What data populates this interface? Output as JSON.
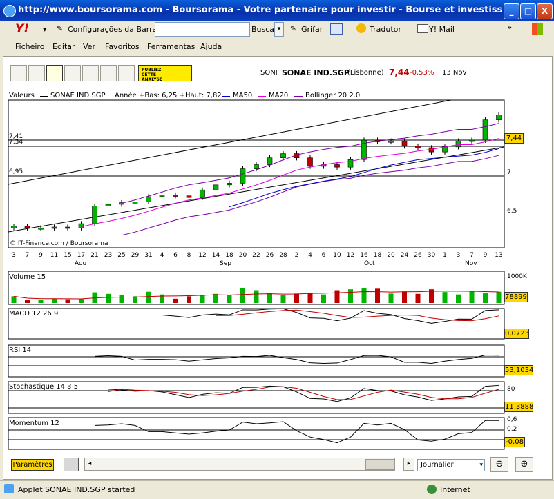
{
  "window": {
    "title": "http://www.boursorama.com - Boursorama - Votre partenaire pour investir - Bourse et investissem - Microsoft ...",
    "buttons": [
      "_",
      "□",
      "X"
    ]
  },
  "ie_toolbar": {
    "yahoo": "Y!",
    "config": "Configurações da Barra",
    "search_btn": "Buscar",
    "grifar": "Grifar",
    "tradutor": "Tradutor",
    "ymail": "Y! Mail"
  },
  "menu": [
    "Ficheiro",
    "Editar",
    "Ver",
    "Favoritos",
    "Ferramentas",
    "Ajuda"
  ],
  "chart_header": {
    "publiez": "PUBLIEZ CETTE ANALYSE",
    "code": "SONI",
    "name": "SONAE IND.SGP",
    "exchange": "(Lisbonne)",
    "price": "7,44",
    "change": "-0,53%",
    "date": "13 Nov"
  },
  "legend": {
    "valeurs": "Valeurs",
    "series": "SONAE IND.SGP",
    "annee": "Année +Bas: 6,25 +Haut: 7,82",
    "ma50": "MA50",
    "ma20": "MA20",
    "bollinger": "Bollinger 20 2.0"
  },
  "colors": {
    "ma50": "#0000CC",
    "ma20": "#DD00DD",
    "bollinger": "#7A00AA",
    "up": "#00B400",
    "down": "#C00000",
    "badge": "#FFD700"
  },
  "copyright": "© IT-Finance.com / Boursorama",
  "price_panel": {
    "right_ticks": [
      "7",
      "6,5"
    ],
    "left_levels": [
      "7,41",
      "7,34",
      "6,95"
    ],
    "last": "7,44"
  },
  "x_days": [
    "3",
    "7",
    "9",
    "11",
    "15",
    "17",
    "21",
    "23",
    "25",
    "29",
    "31",
    "4",
    "6",
    "8",
    "12",
    "14",
    "18",
    "20",
    "22",
    "26",
    "28",
    "2",
    "4",
    "6",
    "10",
    "12",
    "16",
    "18",
    "20",
    "24",
    "26",
    "30",
    "1",
    "3",
    "7",
    "9",
    "13"
  ],
  "months": [
    "Aou",
    "Sep",
    "Oct",
    "Nov"
  ],
  "panels": {
    "volume": {
      "label": "Volume 15",
      "scale": "1000K",
      "value": "78899"
    },
    "macd": {
      "label": "MACD 12 26 9",
      "value": "0,0723"
    },
    "rsi": {
      "label": "RSI 14",
      "value": "53,1034"
    },
    "stoch": {
      "label": "Stochastique 14 3 5",
      "scale": "80",
      "value": "11,3888"
    },
    "momentum": {
      "label": "Momentum 12",
      "scale_top": "0,6",
      "scale_mid": "0,2",
      "value": "-0,08"
    }
  },
  "bottom": {
    "params": "Paramètres",
    "period": "Journalier"
  },
  "status": {
    "text": "Applet SONAE IND.SGP started",
    "zone": "Internet"
  },
  "chart_data": {
    "type": "candlestick",
    "title": "SONAE IND.SGP",
    "ylim": [
      6.25,
      7.82
    ],
    "categories": [
      "3",
      "7",
      "9",
      "11",
      "15",
      "17",
      "21",
      "23",
      "25",
      "29",
      "31",
      "4",
      "6",
      "8",
      "12",
      "14",
      "18",
      "20",
      "22",
      "26",
      "28",
      "2",
      "4",
      "6",
      "10",
      "12",
      "16",
      "18",
      "20",
      "24",
      "26",
      "30",
      "1",
      "3",
      "7",
      "9",
      "13"
    ],
    "close": [
      6.35,
      6.33,
      6.33,
      6.34,
      6.33,
      6.38,
      6.59,
      6.61,
      6.63,
      6.64,
      6.7,
      6.72,
      6.71,
      6.69,
      6.78,
      6.84,
      6.86,
      7.03,
      7.08,
      7.16,
      7.21,
      7.16,
      7.06,
      7.08,
      7.05,
      7.14,
      7.37,
      7.35,
      7.36,
      7.3,
      7.28,
      7.23,
      7.29,
      7.36,
      7.37,
      7.61,
      7.67
    ],
    "volume_k": [
      220,
      100,
      110,
      140,
      120,
      130,
      350,
      300,
      260,
      220,
      370,
      280,
      140,
      220,
      250,
      300,
      270,
      480,
      420,
      320,
      250,
      310,
      330,
      280,
      420,
      450,
      480,
      470,
      310,
      380,
      300,
      450,
      360,
      280,
      380,
      340,
      370
    ]
  }
}
